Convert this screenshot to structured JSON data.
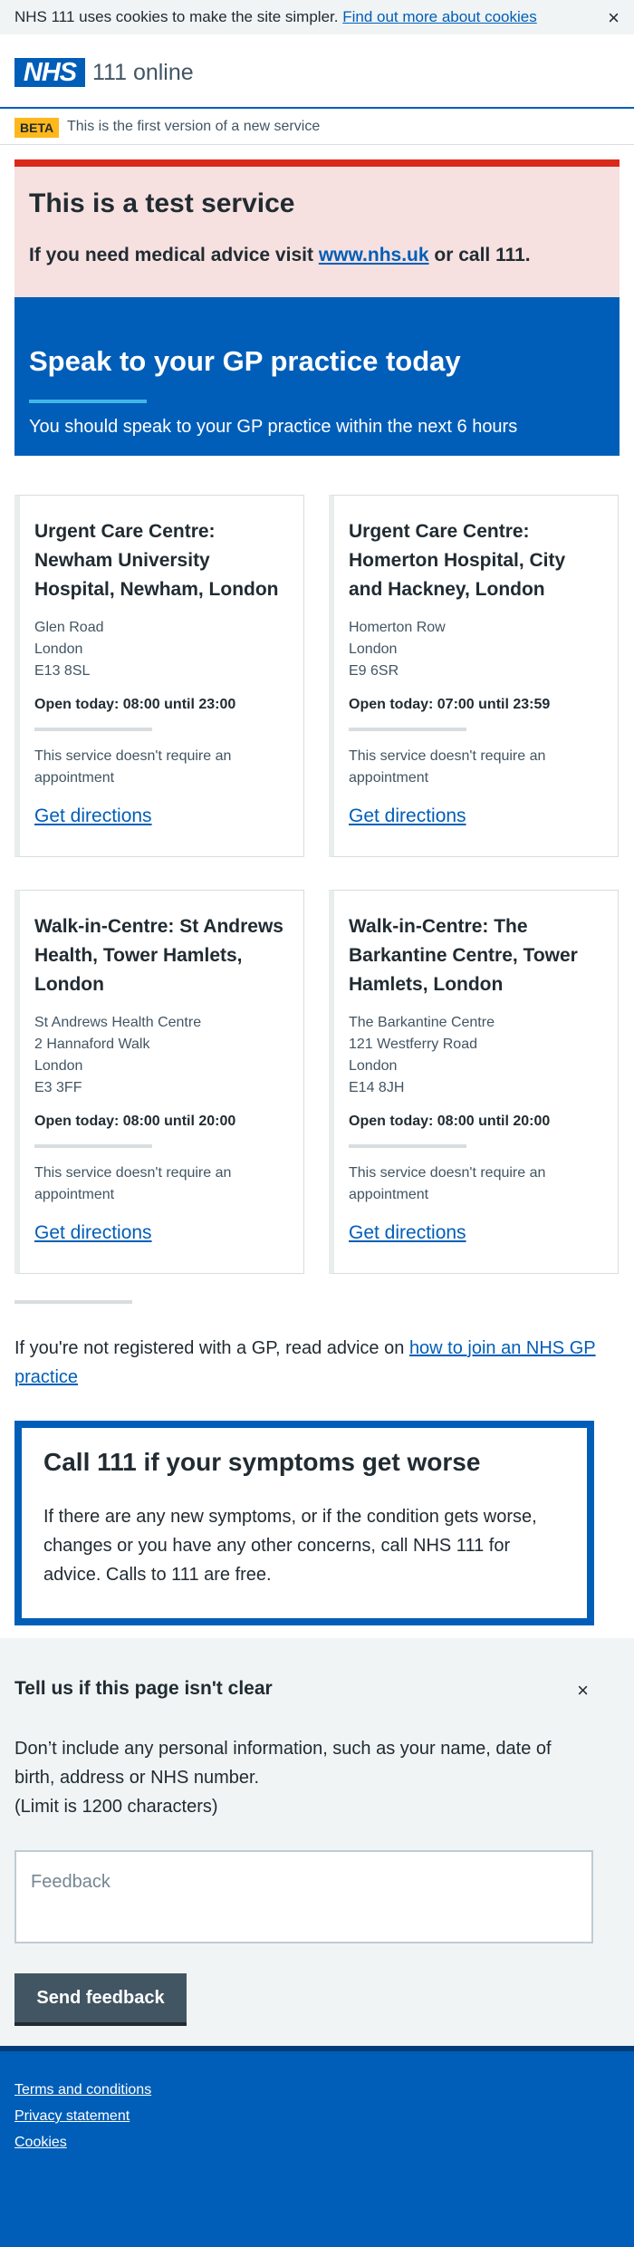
{
  "cookie_banner": {
    "text": "NHS 111 uses cookies to make the site simpler.",
    "link": "Find out more about cookies",
    "close": "×"
  },
  "header": {
    "logo": "NHS",
    "service_name": "111 online"
  },
  "beta": {
    "tag": "BETA",
    "text": "This is the first version of a new service"
  },
  "test_service": {
    "title": "This is a test service",
    "text_before": "If you need medical advice visit",
    "link": "www.nhs.uk",
    "text_after": "or call 111."
  },
  "care_advice": {
    "title": "Speak to your GP practice today",
    "subtitle": "You should speak to your GP practice within the next 6 hours"
  },
  "services": [
    {
      "name": "Urgent Care Centre: Newham University Hospital, Newham, London",
      "address": [
        "Glen Road",
        "London",
        "E13 8SL"
      ],
      "opening": "Open today: 08:00 until 23:00",
      "appointment": "This service doesn't require an appointment",
      "directions": "Get directions"
    },
    {
      "name": "Urgent Care Centre: Homerton Hospital, City and Hackney, London",
      "address": [
        "Homerton Row",
        "London",
        "E9 6SR"
      ],
      "opening": "Open today: 07:00 until 23:59",
      "appointment": "This service doesn't require an appointment",
      "directions": "Get directions"
    },
    {
      "name": "Walk-in-Centre: St Andrews Health, Tower Hamlets, London",
      "address": [
        "St Andrews Health Centre",
        "2 Hannaford Walk",
        "London",
        "E3 3FF"
      ],
      "opening": "Open today: 08:00 until 20:00",
      "appointment": "This service doesn't require an appointment",
      "directions": "Get directions"
    },
    {
      "name": "Walk-in-Centre: The Barkantine Centre, Tower Hamlets, London",
      "address": [
        "The Barkantine Centre",
        "121 Westferry Road",
        "London",
        "E14 8JH"
      ],
      "opening": "Open today: 08:00 until 20:00",
      "appointment": "This service doesn't require an appointment",
      "directions": "Get directions"
    }
  ],
  "gp_advice": {
    "text": "If you're not registered with a GP, read advice on",
    "link": "how to join an NHS GP practice"
  },
  "worse": {
    "title": "Call 111 if your symptoms get worse",
    "text": "If there are any new symptoms, or if the condition gets worse, changes or you have any other concerns, call NHS 111 for advice. Calls to 111 are free."
  },
  "feedback": {
    "title": "Tell us if this page isn't clear",
    "close": "×",
    "info": "Don’t include any personal information, such as your name, date of birth, address or NHS number.",
    "limit": "(Limit is 1200 characters)",
    "placeholder": "Feedback",
    "button": "Send feedback"
  },
  "footer": {
    "links": [
      "Terms and conditions",
      "Privacy statement",
      "Cookies"
    ]
  },
  "colors": {
    "nhs_blue": "#005eb8",
    "warning_red": "#da291c",
    "warning_bg": "#f6e1e0",
    "beta_yellow": "#ffb81c"
  }
}
